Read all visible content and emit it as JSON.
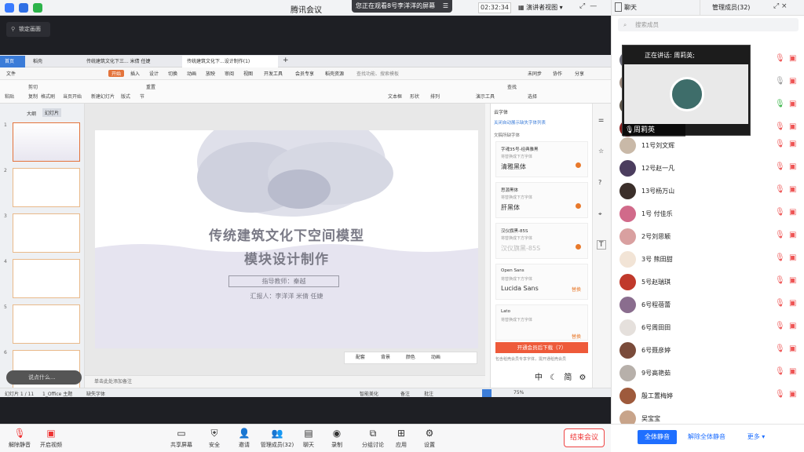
{
  "topbar": {
    "meeting_title": "腾讯会议",
    "watching_banner": "您正在观看8号李洋洋的屏幕",
    "timer": "02:32:34",
    "presenter_view": "演讲者视图"
  },
  "stage": {
    "lock_label": "锁定画面"
  },
  "wps": {
    "tabs": [
      "首页",
      "稻壳",
      "传统建筑文化下三... 米倩 任婕",
      "传统建筑文化下...设计制作(1)"
    ],
    "menu": [
      "文件",
      "开始",
      "插入",
      "设计",
      "切换",
      "动画",
      "放映",
      "审阅",
      "视图",
      "开发工具",
      "会员专享",
      "稻壳资源",
      "查找功能、搜索模板"
    ],
    "menu_right": [
      "未同步",
      "协作",
      "分享"
    ],
    "ribbon": [
      "粘贴",
      "剪切",
      "复制",
      "格式刷",
      "当页开始",
      "新建幻灯片",
      "版式",
      "节",
      "重置",
      "文本框",
      "形状",
      "排列",
      "演示工具",
      "查找",
      "选择"
    ],
    "left_tabs": [
      "大纲",
      "幻灯片"
    ],
    "thumb_numbers": [
      "1",
      "2",
      "3",
      "4",
      "5",
      "6"
    ],
    "slide": {
      "title1": "传统建筑文化下空间模型",
      "title2": "模块设计制作",
      "teacher": "指导教师：秦越",
      "reporter": "汇报人：李洋洋  米倩  任婕"
    },
    "notes_placeholder": "单击此处添加备注",
    "float_tools": [
      "配套",
      "背景",
      "颜色",
      "动画"
    ],
    "font_panel": {
      "header": "云字体",
      "subheader": "关闭自动展示缺失字体列表",
      "section": "文稿所缺字体",
      "fonts": [
        {
          "name": "字魂35号-经典雅黑",
          "status": "将替换成下方字体",
          "preview": "清雅黑体"
        },
        {
          "name": "思源黑体",
          "status": "将替换成下方字体",
          "preview": "肝黑体"
        },
        {
          "name": "汉仪旗黑-85S",
          "status": "将替换成下方字体",
          "preview": "汉仪旗黑-85S"
        },
        {
          "name": "Open Sans",
          "status": "将替换成下方字体",
          "preview": "Lucida Sans",
          "action": "替换"
        },
        {
          "name": "Lato",
          "status": "将替换成下方字体",
          "preview": "",
          "action": "替换"
        }
      ],
      "download_btn": "开通会员后下载（7）",
      "notice": "包含稻壳会员专享字体，需开通稻壳会员"
    },
    "ime": "中",
    "ime_jian": "简",
    "status": {
      "slide_count": "幻灯片 1 / 11",
      "theme": "1_Office 主题",
      "missing_font": "缺失字体",
      "beautify": "智能美化",
      "notes": "备注",
      "comments": "批注",
      "zoom": "75%"
    }
  },
  "bottom_toolbar": [
    "解除静音",
    "开启视频",
    "共享屏幕",
    "安全",
    "邀请",
    "管理成员(32)",
    "聊天",
    "录制",
    "分组讨论",
    "应用",
    "设置"
  ],
  "end_meeting": "结束会议",
  "chat_bubble": "说点什么...",
  "sidebar": {
    "tabs": [
      "聊天",
      "管理成员(32)"
    ],
    "search_placeholder": "搜索成员",
    "speaking_label": "正在讲话: 周莉英;",
    "speaker_name": "周莉英",
    "members": [
      "11号刘文辉",
      "12号赵一凡",
      "13号杨万山",
      "1号 付佳乐",
      "2号刘思颖",
      "3号 熊田甜",
      "5号赵瑞琪",
      "6号程蓓蕾",
      "6号周田田",
      "6号聂彦婷",
      "9号高艳茹",
      "殷工置梅婷",
      "吴宝宝"
    ],
    "footer": [
      "全体静音",
      "解除全体静音",
      "更多"
    ]
  },
  "colors": {
    "accent_blue": "#1f6fff",
    "danger_red": "#e53935",
    "wps_orange": "#e3733b"
  }
}
